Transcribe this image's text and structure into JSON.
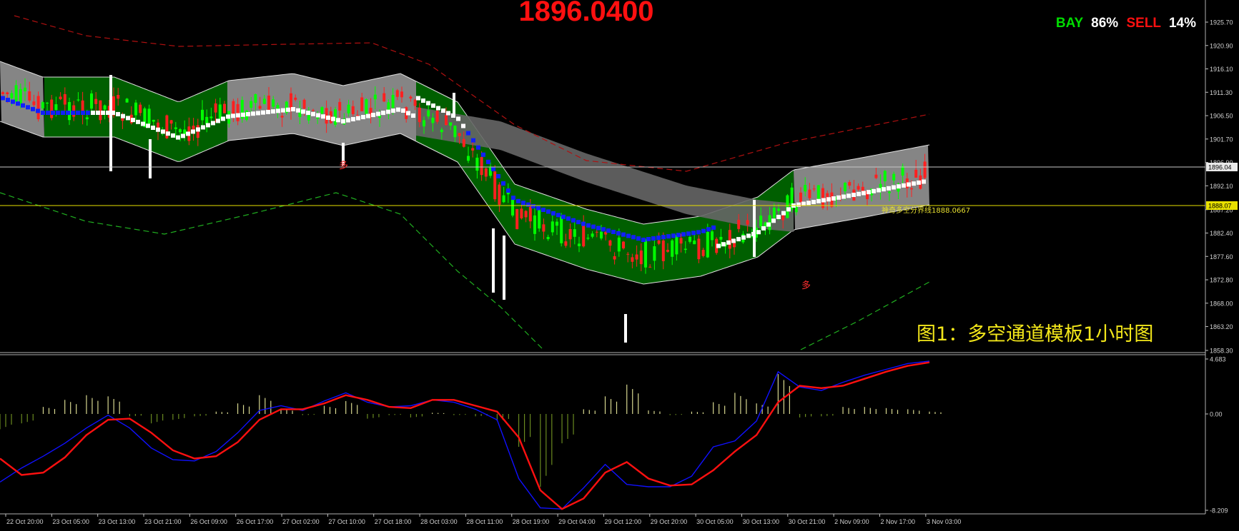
{
  "header": {
    "current_price": "1896.0400",
    "bay_label": "BAY",
    "bay_pct": "86%",
    "sell_label": "SELL",
    "sell_pct": "14%",
    "top_note": "",
    "caption": "图1：多空通道模板1小时图"
  },
  "colors": {
    "background": "#000000",
    "bull_candle": "#00ff00",
    "bear_candle": "#ff2020",
    "channel_green": "#006400",
    "channel_gray": "#8c8c8c",
    "price_line": "#ffff00",
    "macd_blue": "#1010ff",
    "macd_red": "#ff1010",
    "histogram": "#d8d890",
    "price_color": "#ff1010",
    "bay_color": "#00dd00",
    "sell_color": "#ff1010"
  },
  "icons": [
    "arrow-down-marker-icon"
  ],
  "chart_data": [
    {
      "type": "candlestick",
      "title": "",
      "y_ticks": [
        "1925.70",
        "1920.90",
        "1916.10",
        "1911.30",
        "1906.50",
        "1901.70",
        "1896.90",
        "1892.10",
        "1887.20",
        "1882.40",
        "1877.60",
        "1872.80",
        "1868.00",
        "1863.20",
        "1858.30"
      ],
      "ylim": [
        1858.3,
        1926.0
      ],
      "x_ticks": [
        "22 Oct 20:00",
        "23 Oct 05:00",
        "23 Oct 13:00",
        "23 Oct 21:00",
        "26 Oct 09:00",
        "26 Oct 17:00",
        "27 Oct 02:00",
        "27 Oct 10:00",
        "27 Oct 18:00",
        "28 Oct 03:00",
        "28 Oct 11:00",
        "28 Oct 19:00",
        "29 Oct 04:00",
        "29 Oct 12:00",
        "29 Oct 20:00",
        "30 Oct 05:00",
        "30 Oct 13:00",
        "30 Oct 21:00",
        "2 Nov 09:00",
        "2 Nov 17:00",
        "3 Nov 03:00"
      ],
      "current_price_label": "1896.04",
      "current_price": 1896.04,
      "level_price_label": "1888.07",
      "level_price": 1888.07,
      "level_line_text": "神奇多空分界线1888.0667",
      "markers": [
        {
          "label": "多",
          "x": "27 Oct 10:00",
          "price": 1894.0
        },
        {
          "label": "多",
          "x": "30 Oct 21:00",
          "price": 1873.2
        }
      ]
    },
    {
      "type": "line",
      "title": "",
      "y_ticks": [
        "4.683",
        "0.00",
        "-8.209"
      ],
      "ylim": [
        -8.209,
        4.683
      ],
      "series": [
        {
          "name": "",
          "color": "#1010ff",
          "values": [
            -5.8,
            -4.6,
            -3.6,
            -2.5,
            -1.2,
            -0.1,
            -1.2,
            -2.9,
            -3.9,
            -4.0,
            -3.2,
            -1.6,
            0.3,
            0.7,
            0.3,
            1.1,
            1.8,
            1.0,
            0.6,
            0.7,
            1.2,
            1.0,
            0.4,
            -0.5,
            -5.5,
            -8.0,
            -8.1,
            -6.3,
            -4.3,
            -6.0,
            -6.2,
            -6.2,
            -5.3,
            -2.8,
            -2.3,
            -0.6,
            3.6,
            2.3,
            2.0,
            2.7,
            3.3,
            3.8,
            4.3,
            4.5
          ]
        },
        {
          "name": "",
          "color": "#ff1010",
          "values": [
            -3.8,
            -5.2,
            -5.0,
            -3.7,
            -1.8,
            -0.5,
            -0.4,
            -1.6,
            -3.1,
            -3.8,
            -3.6,
            -2.4,
            -0.5,
            0.4,
            0.4,
            0.9,
            1.6,
            1.2,
            0.6,
            0.5,
            1.2,
            1.2,
            0.7,
            0.2,
            -2.0,
            -6.5,
            -8.1,
            -7.2,
            -5.0,
            -4.1,
            -5.5,
            -6.1,
            -6.0,
            -4.8,
            -3.2,
            -1.8,
            1.0,
            2.4,
            2.2,
            2.4,
            3.0,
            3.6,
            4.1,
            4.4
          ]
        }
      ],
      "histogram": [
        -1.3,
        -0.8,
        0.6,
        1.2,
        1.6,
        1.5,
        -0.2,
        -0.8,
        -0.5,
        -0.2,
        0.2,
        0.9,
        1.6,
        0.4,
        -0.1,
        0.7,
        1.1,
        -0.4,
        -0.1,
        -0.3,
        0.1,
        -0.1,
        -0.2,
        -0.6,
        -2.8,
        -6.2,
        -2.5,
        0.4,
        1.5,
        2.5,
        0.3,
        -0.1,
        0.2,
        1.0,
        1.8,
        0.9,
        3.4,
        -0.3,
        -0.2,
        0.6,
        0.6,
        0.5,
        0.4,
        0.2
      ]
    }
  ]
}
